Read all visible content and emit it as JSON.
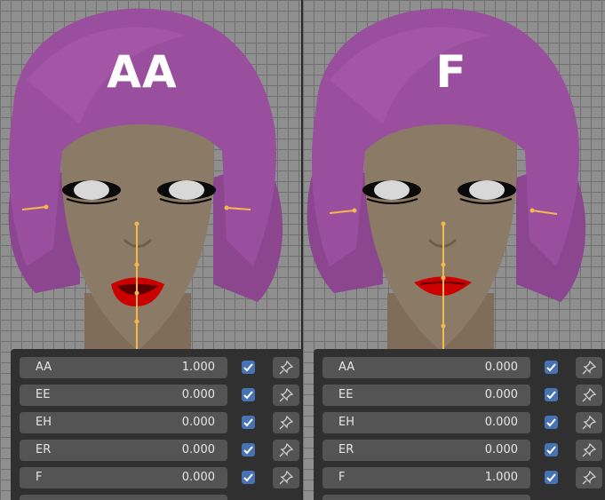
{
  "colors": {
    "hair": "#9a4f9e",
    "skin": "#8a7864",
    "lips": "#cc0000",
    "bone": "#f4b94e",
    "checkbox": "#4772b3",
    "field_bg": "#545454"
  },
  "panels": [
    {
      "title": "AA",
      "rows": [
        {
          "name": "AA",
          "value": "1.000"
        },
        {
          "name": "EE",
          "value": "0.000"
        },
        {
          "name": "EH",
          "value": "0.000"
        },
        {
          "name": "ER",
          "value": "0.000"
        },
        {
          "name": "F",
          "value": "0.000"
        }
      ]
    },
    {
      "title": "F",
      "rows": [
        {
          "name": "AA",
          "value": "0.000"
        },
        {
          "name": "EE",
          "value": "0.000"
        },
        {
          "name": "EH",
          "value": "0.000"
        },
        {
          "name": "ER",
          "value": "0.000"
        },
        {
          "name": "F",
          "value": "1.000"
        }
      ]
    }
  ],
  "icons": {
    "checkbox": "checkmark-icon",
    "pin": "pin-icon"
  }
}
